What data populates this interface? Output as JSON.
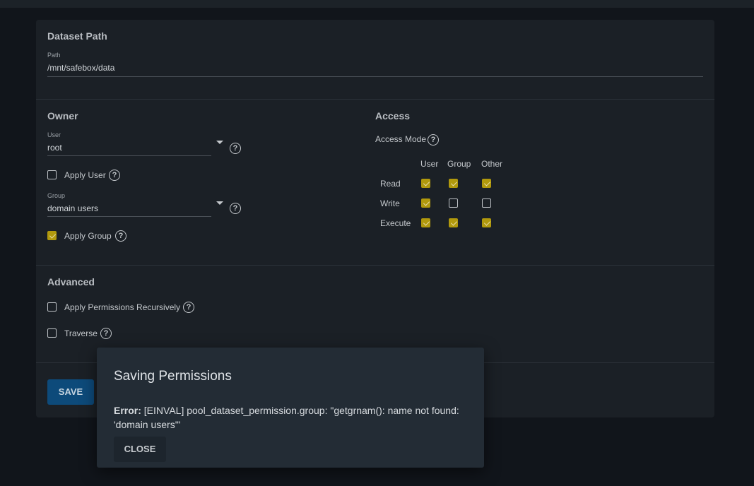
{
  "dataset_path": {
    "title": "Dataset Path",
    "path_label": "Path",
    "path_value": "/mnt/safebox/data"
  },
  "owner": {
    "title": "Owner",
    "user_label": "User",
    "user_value": "root",
    "apply_user_label": "Apply User",
    "apply_user_checked": false,
    "group_label": "Group",
    "group_value": "domain users",
    "apply_group_label": "Apply Group",
    "apply_group_checked": true
  },
  "access": {
    "title": "Access",
    "mode_label": "Access Mode",
    "columns": [
      "User",
      "Group",
      "Other"
    ],
    "rows": [
      {
        "label": "Read",
        "values": [
          true,
          true,
          true
        ]
      },
      {
        "label": "Write",
        "values": [
          true,
          false,
          false
        ]
      },
      {
        "label": "Execute",
        "values": [
          true,
          true,
          true
        ]
      }
    ]
  },
  "advanced": {
    "title": "Advanced",
    "recursive_label": "Apply Permissions Recursively",
    "recursive_checked": false,
    "traverse_label": "Traverse",
    "traverse_checked": false
  },
  "actions": {
    "save_label": "SAVE"
  },
  "dialog": {
    "title": "Saving Permissions",
    "error_prefix": "Error:",
    "error_message": " [EINVAL] pool_dataset_permission.group: \"getgrnam(): name not found: 'domain users'\"",
    "close_label": "CLOSE"
  },
  "colors": {
    "accent_checkbox": "#b1990d",
    "primary_button": "#0d4a7a"
  }
}
